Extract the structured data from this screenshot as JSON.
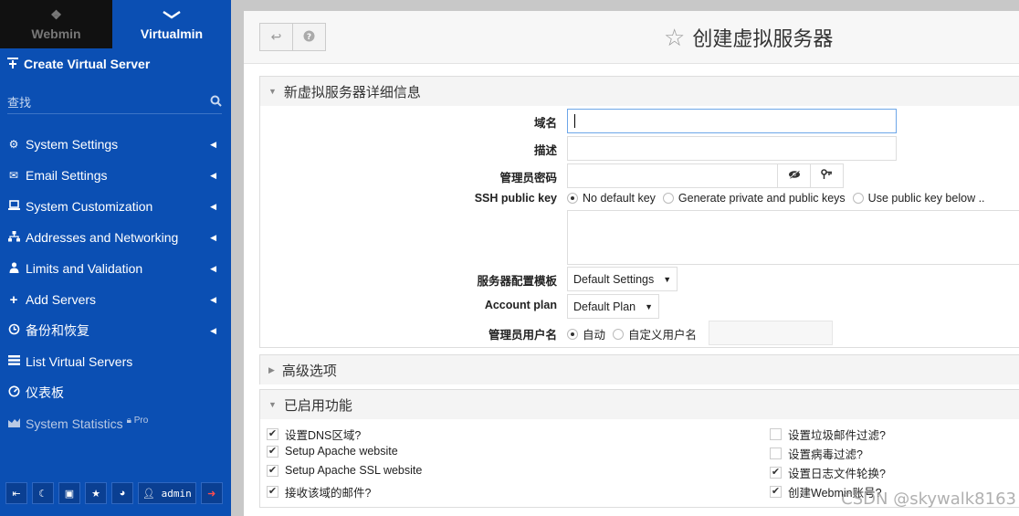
{
  "sidebar": {
    "tabs": [
      {
        "label": "Webmin",
        "icon": "webmin-logo-icon"
      },
      {
        "label": "Virtualmin",
        "icon": "chevron-down-icon"
      }
    ],
    "create_label": "Create Virtual Server",
    "search_placeholder": "查找",
    "items": [
      {
        "label": "System Settings",
        "icon": "gear-icon"
      },
      {
        "label": "Email Settings",
        "icon": "envelope-icon"
      },
      {
        "label": "System Customization",
        "icon": "laptop-icon"
      },
      {
        "label": "Addresses and Networking",
        "icon": "network-icon"
      },
      {
        "label": "Limits and Validation",
        "icon": "users-icon"
      },
      {
        "label": "Add Servers",
        "icon": "plus-icon"
      },
      {
        "label": "备份和恢复",
        "icon": "history-icon"
      },
      {
        "label": "List Virtual Servers",
        "icon": "list-icon"
      },
      {
        "label": "仪表板",
        "icon": "dashboard-icon"
      },
      {
        "label": "System Statistics",
        "icon": "area-chart-icon",
        "badge": "Pro"
      }
    ],
    "bottom": {
      "admin_label": "admin"
    }
  },
  "header": {
    "title": "创建虚拟服务器"
  },
  "details_panel": {
    "title": "新虚拟服务器详细信息",
    "domain_label": "域名",
    "domain_value": "",
    "desc_label": "描述",
    "desc_value": "",
    "password_label": "管理员密码",
    "ssh_label": "SSH public key",
    "ssh_options": [
      "No default key",
      "Generate private and public keys",
      "Use public key below .."
    ],
    "template_label": "服务器配置模板",
    "template_value": "Default Settings",
    "plan_label": "Account plan",
    "plan_value": "Default Plan",
    "admin_user_label": "管理员用户名",
    "admin_user_options": [
      "自动",
      "自定义用户名"
    ]
  },
  "advanced_panel": {
    "title": "高级选项"
  },
  "features_panel": {
    "title": "已启用功能",
    "left": [
      {
        "label": "设置DNS区域?",
        "checked": true
      },
      {
        "label": "Setup Apache website",
        "checked": true
      },
      {
        "label": "Setup Apache SSL website",
        "checked": true
      },
      {
        "label": "接收该域的邮件?",
        "checked": true
      }
    ],
    "right": [
      {
        "label": "设置垃圾邮件过滤?",
        "checked": false
      },
      {
        "label": "设置病毒过滤?",
        "checked": false
      },
      {
        "label": "设置日志文件轮换?",
        "checked": true
      },
      {
        "label": "创建Webmin账号?",
        "checked": true
      }
    ]
  },
  "watermark": "CSDN @skywalk8163"
}
